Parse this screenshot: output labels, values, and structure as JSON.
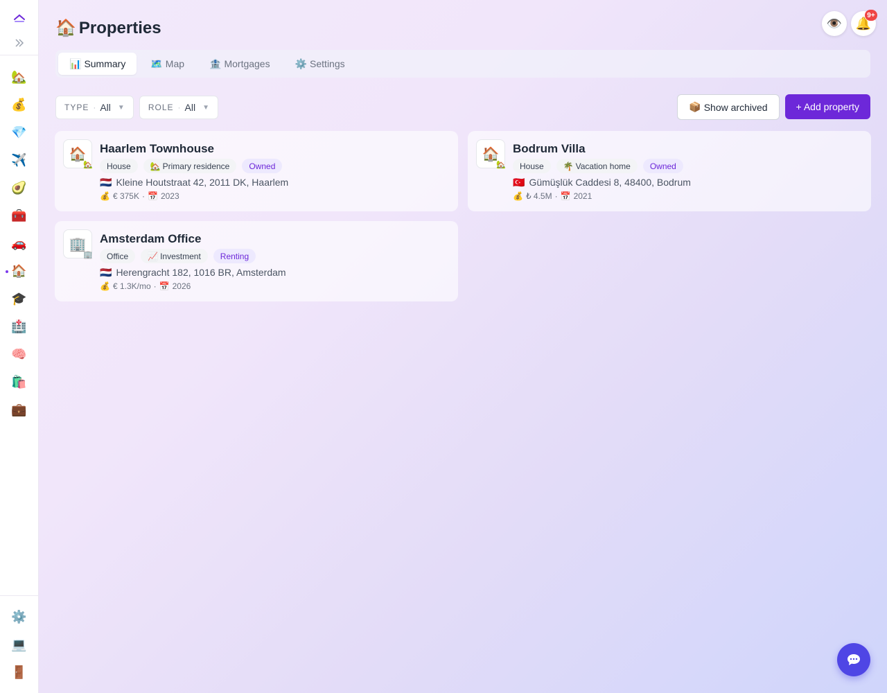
{
  "sidebar": {
    "top": [
      {
        "icon": "up-chevron-icon"
      },
      {
        "icon": "expand-icon"
      }
    ],
    "items": [
      {
        "icon": "properties-icon",
        "glyph": "🏡"
      },
      {
        "icon": "money-bag-icon",
        "glyph": "💰"
      },
      {
        "icon": "gem-icon",
        "glyph": "💎"
      },
      {
        "icon": "airplane-icon",
        "glyph": "✈️"
      },
      {
        "icon": "avocado-icon",
        "glyph": "🥑"
      },
      {
        "icon": "toolbox-icon",
        "glyph": "🧰"
      },
      {
        "icon": "car-icon",
        "glyph": "🚗"
      },
      {
        "icon": "house-icon",
        "glyph": "🏠",
        "active": true
      },
      {
        "icon": "graduation-cap-icon",
        "glyph": "🎓"
      },
      {
        "icon": "hospital-icon",
        "glyph": "🏥"
      },
      {
        "icon": "brain-icon",
        "glyph": "🧠"
      },
      {
        "icon": "shopping-bags-icon",
        "glyph": "🛍️"
      },
      {
        "icon": "briefcase-icon",
        "glyph": "💼"
      }
    ],
    "bottom": [
      {
        "icon": "gear-icon",
        "glyph": "⚙️"
      },
      {
        "icon": "laptop-icon",
        "glyph": "💻"
      },
      {
        "icon": "door-icon",
        "glyph": "🚪"
      }
    ]
  },
  "header": {
    "title_icon": "🏠",
    "title": "Properties",
    "eye_icon": "👁️",
    "bell_icon": "🔔",
    "notification_count": "9+"
  },
  "tabs": [
    {
      "icon": "📊",
      "label": "Summary",
      "active": true
    },
    {
      "icon": "🗺️",
      "label": "Map"
    },
    {
      "icon": "🏦",
      "label": "Mortgages"
    },
    {
      "icon": "⚙️",
      "label": "Settings"
    }
  ],
  "filters": {
    "type": {
      "label": "TYPE",
      "value": "All"
    },
    "role": {
      "label": "ROLE",
      "value": "All"
    }
  },
  "actions": {
    "archived_icon": "📦",
    "show_archived": "Show archived",
    "add_property": "+ Add property"
  },
  "properties": [
    {
      "thumb": "🏠",
      "mini": "🏡",
      "name": "Haarlem Townhouse",
      "type": "House",
      "role_icon": "🏡",
      "role": "Primary residence",
      "status": "Owned",
      "flag": "🇳🇱",
      "address": "Kleine Houtstraat 42, 2011 DK, Haarlem",
      "value_icon": "💰",
      "value": "€ 375K",
      "year_icon": "📅",
      "year": "2023"
    },
    {
      "thumb": "🏠",
      "mini": "🏡",
      "name": "Bodrum Villa",
      "type": "House",
      "role_icon": "🌴",
      "role": "Vacation home",
      "status": "Owned",
      "flag": "🇹🇷",
      "address": "Gümüşlük Caddesi 8, 48400, Bodrum",
      "value_icon": "💰",
      "value": "₺ 4.5M",
      "year_icon": "📅",
      "year": "2021"
    },
    {
      "thumb": "🏢",
      "mini": "🏢",
      "name": "Amsterdam Office",
      "type": "Office",
      "role_icon": "📈",
      "role": "Investment",
      "status": "Renting",
      "flag": "🇳🇱",
      "address": "Herengracht 182, 1016 BR, Amsterdam",
      "value_icon": "💰",
      "value": "€ 1.3K/mo",
      "year_icon": "📅",
      "year": "2026"
    }
  ],
  "chat": {
    "icon": "chat-icon"
  }
}
